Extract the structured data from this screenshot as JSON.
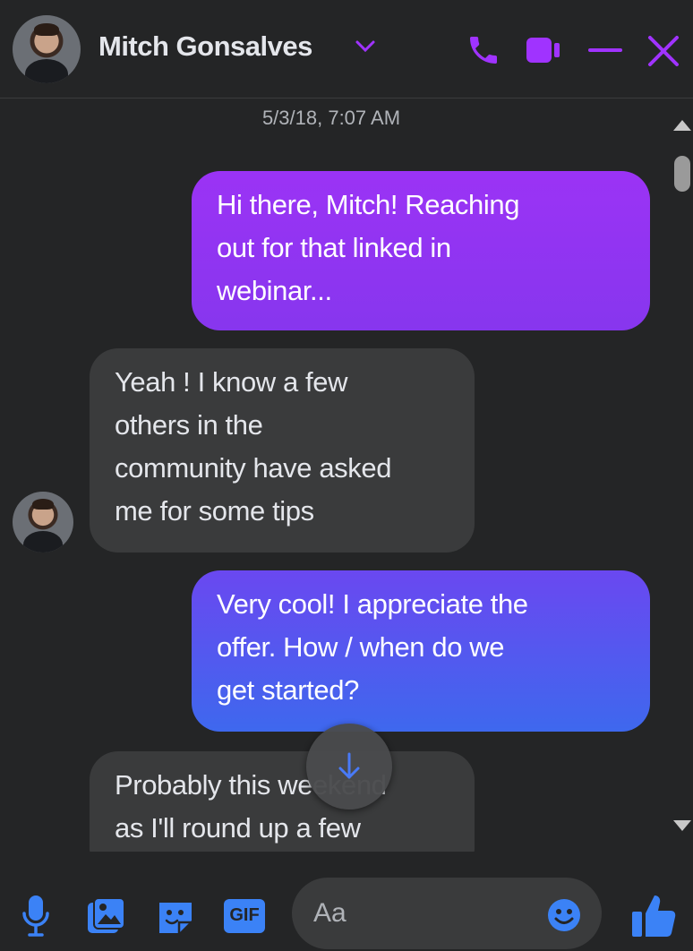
{
  "header": {
    "contact_name": "Mitch Gonsalves",
    "icons": [
      "chevron-down-icon",
      "phone-icon",
      "video-camera-icon",
      "minimize-icon",
      "close-icon"
    ],
    "accent_color": "#a033ff"
  },
  "conversation": {
    "timestamp": "5/3/18, 7:07 AM",
    "messages": [
      {
        "direction": "outgoing",
        "text": "Hi there, Mitch! Reaching\nout for that linked in\nwebinar..."
      },
      {
        "direction": "incoming",
        "text": "Yeah ! I know a few\nothers in the\ncommunity have asked\nme for some tips"
      },
      {
        "direction": "outgoing",
        "text": "Very cool! I appreciate the\noffer. How / when do we\nget started?"
      },
      {
        "direction": "incoming",
        "text": "Probably this weekend\nas I'll round up a few"
      }
    ]
  },
  "composer": {
    "placeholder": "Aa",
    "gif_label": "GIF",
    "icons": [
      "microphone-icon",
      "photo-icon",
      "sticker-icon",
      "gif-icon",
      "emoji-icon",
      "thumbs-up-icon"
    ],
    "icon_color": "#3b82f6"
  }
}
